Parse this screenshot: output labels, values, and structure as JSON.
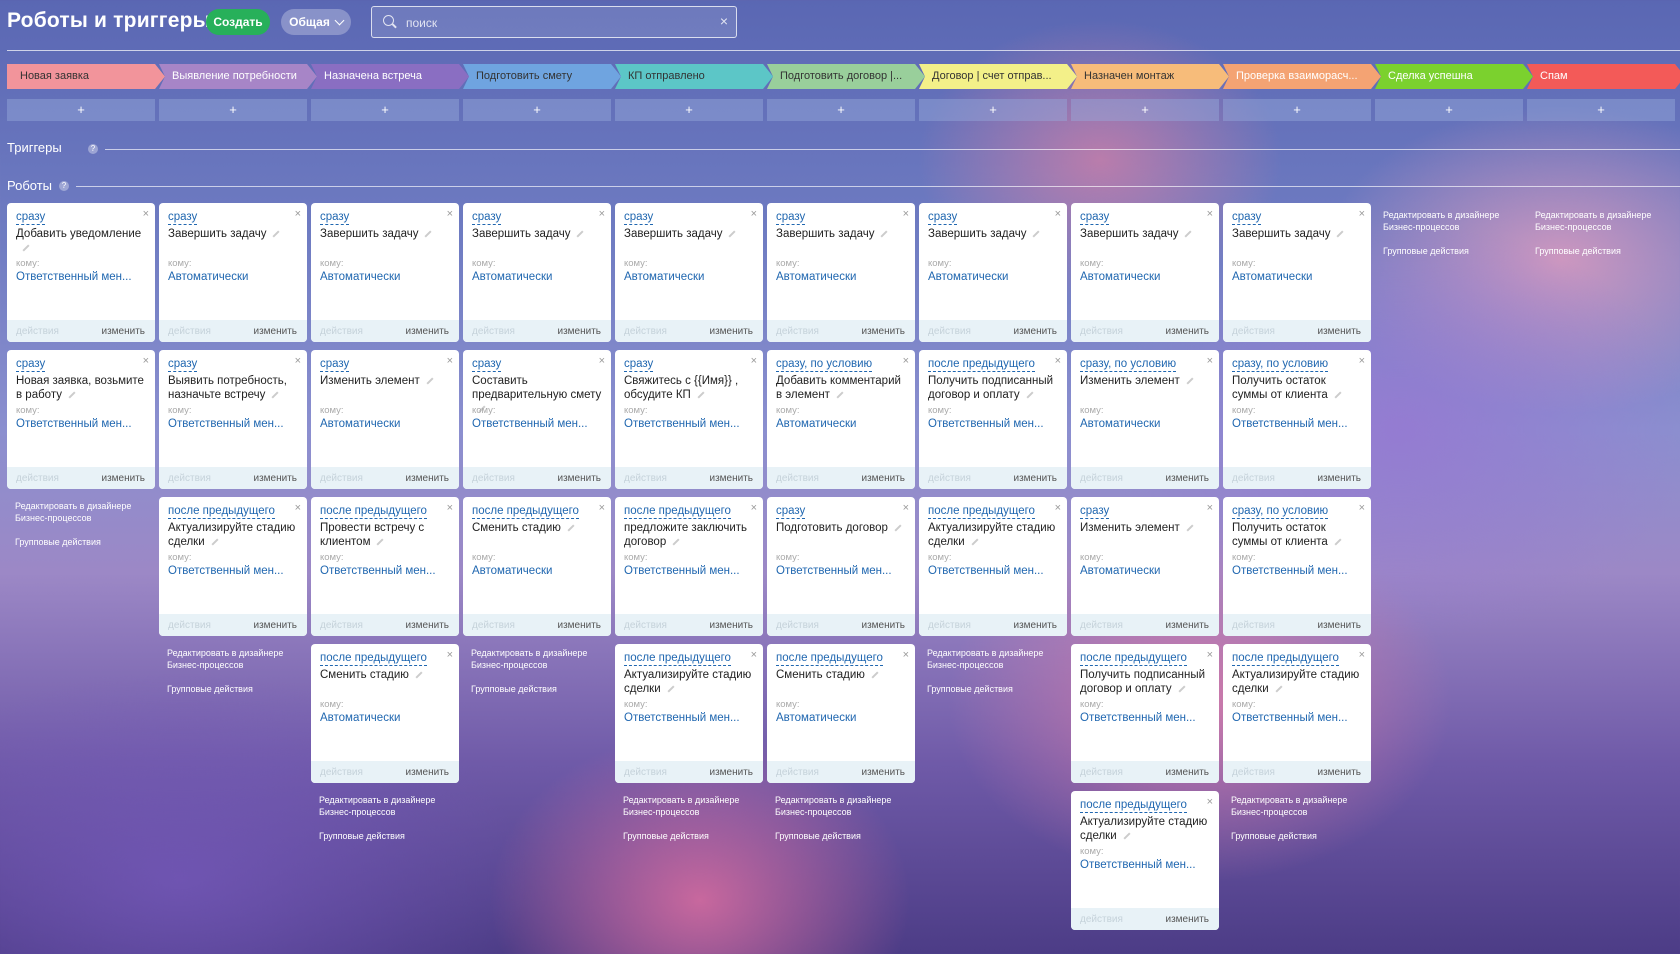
{
  "header": {
    "title": "Роботы и триггеры",
    "create_label": "Создать",
    "general_label": "Общая",
    "search_placeholder": "поиск"
  },
  "stages": [
    {
      "label": "Новая заявка",
      "color": "#f2949b",
      "text_color": "#333"
    },
    {
      "label": "Выявление потребности",
      "color": "#a785c7",
      "text_color": "#fff"
    },
    {
      "label": "Назначена встреча",
      "color": "#8a6ec2",
      "text_color": "#fff"
    },
    {
      "label": "Подготовить смету",
      "color": "#6fa4e0",
      "text_color": "#333"
    },
    {
      "label": "КП отправлено",
      "color": "#5cc6c7",
      "text_color": "#333"
    },
    {
      "label": "Подготовить договор |...",
      "color": "#99cf9b",
      "text_color": "#333"
    },
    {
      "label": "Договор | счет отправ...",
      "color": "#f3f089",
      "text_color": "#333"
    },
    {
      "label": "Назначен монтаж",
      "color": "#f7bc7a",
      "text_color": "#333"
    },
    {
      "label": "Проверка взаиморасч...",
      "color": "#f4a373",
      "text_color": "#fff"
    },
    {
      "label": "Сделка успешна",
      "color": "#7bd12e",
      "text_color": "#fff"
    },
    {
      "label": "Спам",
      "color": "#f35a58",
      "text_color": "#fff"
    }
  ],
  "add_label": "+",
  "triggers_label": "Триггеры",
  "robots_label": "Роботы",
  "help_glyph": "?",
  "to_label": "кому:",
  "actions_label": "действия",
  "edit_label": "изменить",
  "close_glyph": "×",
  "designer_link": "Редактировать в дизайнере Бизнес-процессов",
  "group_actions": "Групповые действия",
  "columns": [
    {
      "robots": [
        {
          "cond": "сразу",
          "name": "Добавить уведомление",
          "to": "Ответственный мен..."
        },
        {
          "cond": "сразу",
          "name": "Новая заявка, возьмите в работу",
          "to": "Ответственный мен..."
        }
      ]
    },
    {
      "robots": [
        {
          "cond": "сразу",
          "name": "Завершить задачу",
          "to": "Автоматически"
        },
        {
          "cond": "сразу",
          "name": "Выявить потребность, назначьте встречу",
          "to": "Ответственный мен..."
        },
        {
          "cond": "после предыдущего",
          "name": "Актуализируйте стадию сделки",
          "to": "Ответственный мен..."
        }
      ]
    },
    {
      "robots": [
        {
          "cond": "сразу",
          "name": "Завершить задачу",
          "to": "Автоматически"
        },
        {
          "cond": "сразу",
          "name": "Изменить элемент",
          "to": "Автоматически"
        },
        {
          "cond": "после предыдущего",
          "name": "Провести встречу с клиентом",
          "to": "Ответственный мен..."
        },
        {
          "cond": "после предыдущего",
          "name": "Сменить стадию",
          "to": "Автоматически"
        }
      ]
    },
    {
      "robots": [
        {
          "cond": "сразу",
          "name": "Завершить задачу",
          "to": "Автоматически"
        },
        {
          "cond": "сразу",
          "name": "Составить предварительную смету",
          "to": "Ответственный мен..."
        },
        {
          "cond": "после предыдущего",
          "name": "Сменить стадию",
          "to": "Автоматически"
        }
      ]
    },
    {
      "robots": [
        {
          "cond": "сразу",
          "name": "Завершить задачу",
          "to": "Автоматически"
        },
        {
          "cond": "сразу",
          "name": "Свяжитесь с {{Имя}} , обсудите КП",
          "to": "Ответственный мен..."
        },
        {
          "cond": "после предыдущего",
          "name": "предложите заключить договор",
          "to": "Ответственный мен..."
        },
        {
          "cond": "после предыдущего",
          "name": "Актуализируйте стадию сделки",
          "to": "Ответственный мен..."
        }
      ]
    },
    {
      "robots": [
        {
          "cond": "сразу",
          "name": "Завершить задачу",
          "to": "Автоматически"
        },
        {
          "cond": "сразу, по условию",
          "name": "Добавить комментарий в элемент",
          "to": "Автоматически"
        },
        {
          "cond": "сразу",
          "name": "Подготовить договор",
          "to": "Ответственный мен..."
        },
        {
          "cond": "после предыдущего",
          "name": "Сменить стадию",
          "to": "Автоматически"
        }
      ]
    },
    {
      "robots": [
        {
          "cond": "сразу",
          "name": "Завершить задачу",
          "to": "Автоматически"
        },
        {
          "cond": "после предыдущего",
          "name": "Получить подписанный договор и оплату",
          "to": "Ответственный мен..."
        },
        {
          "cond": "после предыдущего",
          "name": "Актуализируйте стадию сделки",
          "to": "Ответственный мен..."
        }
      ]
    },
    {
      "robots": [
        {
          "cond": "сразу",
          "name": "Завершить задачу",
          "to": "Автоматически"
        },
        {
          "cond": "сразу, по условию",
          "name": "Изменить элемент",
          "to": "Автоматически"
        },
        {
          "cond": "сразу",
          "name": "Изменить элемент",
          "to": "Автоматически"
        },
        {
          "cond": "после предыдущего",
          "name": "Получить подписанный договор и оплату",
          "to": "Ответственный мен..."
        },
        {
          "cond": "после предыдущего",
          "name": "Актуализируйте стадию сделки",
          "to": "Ответственный мен..."
        }
      ]
    },
    {
      "robots": [
        {
          "cond": "сразу",
          "name": "Завершить задачу",
          "to": "Автоматически"
        },
        {
          "cond": "сразу, по условию",
          "name": "Получить остаток суммы от клиента",
          "to": "Ответственный мен..."
        },
        {
          "cond": "сразу, по условию",
          "name": "Получить остаток суммы от клиента",
          "to": "Ответственный мен..."
        },
        {
          "cond": "после предыдущего",
          "name": "Актуализируйте стадию сделки",
          "to": "Ответственный мен..."
        }
      ]
    },
    {
      "robots": []
    },
    {
      "robots": []
    }
  ]
}
